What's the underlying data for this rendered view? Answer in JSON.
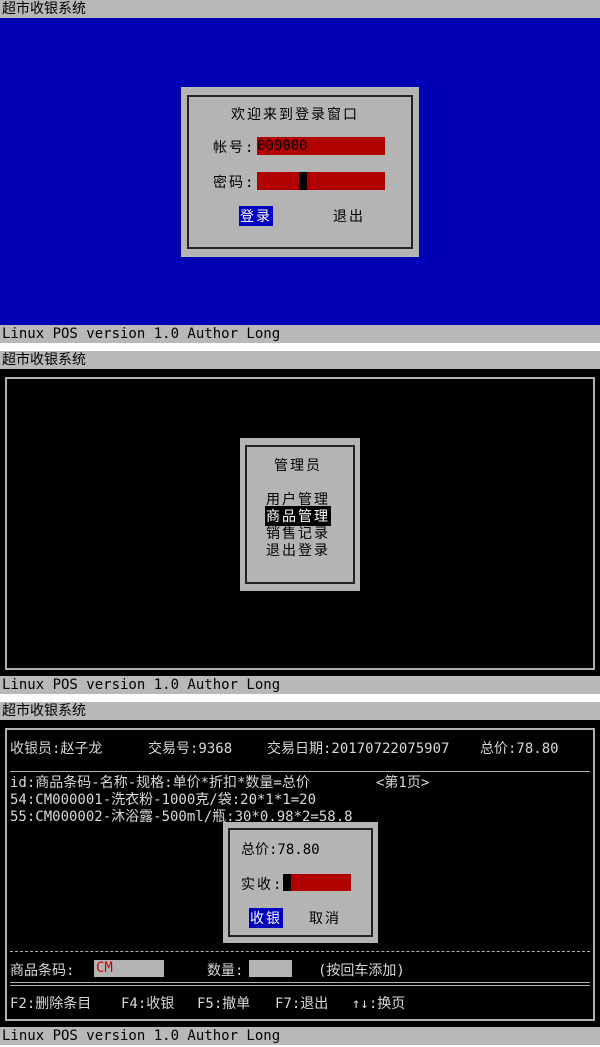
{
  "app_title": "超市收银系统",
  "status_text": "Linux POS version 1.0 Author Long",
  "login": {
    "welcome": "欢迎来到登录窗口",
    "account_label": "帐号:",
    "account_value": "000000",
    "password_label": "密码:",
    "login_button": "登录",
    "exit_button": "退出"
  },
  "menu": {
    "title": "管理员",
    "items": [
      "用户管理",
      "商品管理",
      "销售记录",
      "退出登录"
    ],
    "selected_index": 1
  },
  "checkout": {
    "cashier_label": "收银员:赵子龙",
    "txn_label": "交易号:9368",
    "date_label": "交易日期:20170722075907",
    "total_label": "总价:78.80",
    "list_header": "id:商品条码-名称-规格:单价*折扣*数量=总价",
    "page_label": "<第1页>",
    "rows": [
      "54:CM000001-洗衣粉-1000克/袋:20*1*1=20",
      "55:CM000002-沐浴露-500ml/瓶:30*0.98*2=58.8"
    ],
    "popup": {
      "total": "总价:78.80",
      "paid_label": "实收:",
      "confirm_button": "收银",
      "cancel_button": "取消"
    },
    "barcode_label": "商品条码:",
    "barcode_value": "CM",
    "qty_label": "数量:",
    "hint": "(按回车添加)",
    "shortcuts": [
      "F2:删除条目",
      "F4:收银",
      "F5:撤单",
      "F7:退出",
      "↑↓:换页"
    ],
    "colors": {
      "accent_red": "#b00000",
      "select_blue": "#0000c0"
    }
  }
}
